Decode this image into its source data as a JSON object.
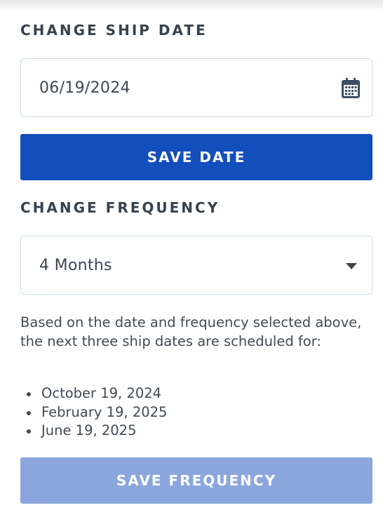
{
  "ship_date": {
    "heading": "CHANGE SHIP DATE",
    "date_value": "06/19/2024",
    "calendar_icon": "calendar-icon",
    "save_label": "SAVE DATE"
  },
  "frequency": {
    "heading": "CHANGE FREQUENCY",
    "selected": "4 Months",
    "dropdown_icon": "chevron-down-icon",
    "info": "Based on the date and frequency selected above, the next three ship dates are scheduled for:",
    "next_dates": [
      "October 19, 2024",
      "February 19, 2025",
      "June 19, 2025"
    ],
    "save_label": "SAVE FREQUENCY"
  },
  "colors": {
    "primary_button": "#134ebd",
    "disabled_button": "#8aa6dd",
    "heading_text": "#37424d",
    "field_border": "#cfdde6"
  }
}
